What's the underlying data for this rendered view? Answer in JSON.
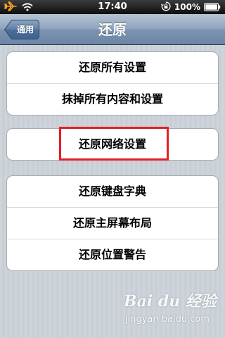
{
  "status_bar": {
    "time": "17:40",
    "battery": "100%",
    "icons": [
      "airplane-icon",
      "wifi-icon",
      "orientation-lock-icon",
      "battery-icon"
    ]
  },
  "nav": {
    "back_label": "通用",
    "title": "还原"
  },
  "groups": [
    {
      "rows": [
        {
          "label": "还原所有设置"
        },
        {
          "label": "抹掉所有内容和设置"
        }
      ]
    },
    {
      "rows": [
        {
          "label": "还原网络设置"
        }
      ]
    },
    {
      "rows": [
        {
          "label": "还原键盘字典"
        },
        {
          "label": "还原主屏幕布局"
        },
        {
          "label": "还原位置警告"
        }
      ]
    }
  ],
  "annotation": {
    "highlight_color": "#e21f26",
    "highlighted_item": "还原网络设置"
  },
  "watermark": {
    "brand": "Bai du 经验",
    "site": "jingyan.baidu.com"
  },
  "colors": {
    "nav_bar": "#7d93b0",
    "background": "#c8cfd6",
    "cell": "#ffffff"
  }
}
